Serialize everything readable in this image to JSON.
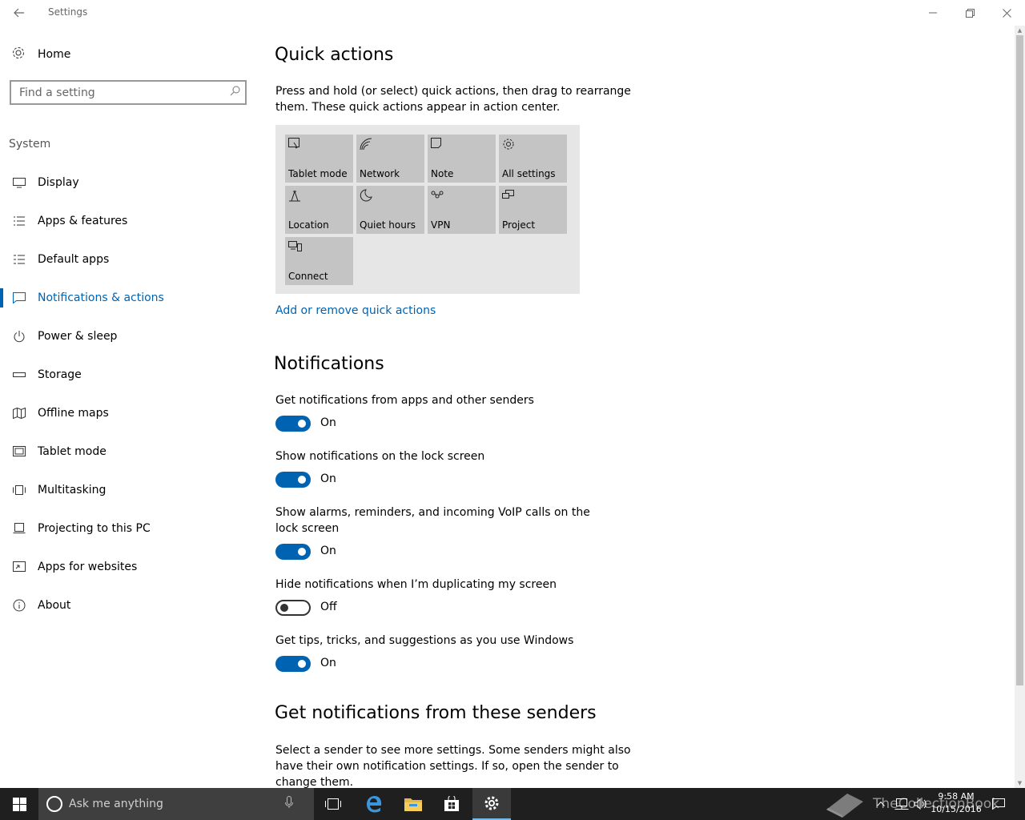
{
  "window": {
    "title": "Settings"
  },
  "sidebar": {
    "home_label": "Home",
    "search_placeholder": "Find a setting",
    "section_label": "System",
    "items": [
      {
        "label": "Display",
        "icon": "monitor-icon"
      },
      {
        "label": "Apps & features",
        "icon": "list-icon"
      },
      {
        "label": "Default apps",
        "icon": "default-apps-icon"
      },
      {
        "label": "Notifications & actions",
        "icon": "notification-icon",
        "active": true
      },
      {
        "label": "Power & sleep",
        "icon": "power-icon"
      },
      {
        "label": "Storage",
        "icon": "storage-icon"
      },
      {
        "label": "Offline maps",
        "icon": "map-icon"
      },
      {
        "label": "Tablet mode",
        "icon": "tablet-icon"
      },
      {
        "label": "Multitasking",
        "icon": "multitasking-icon"
      },
      {
        "label": "Projecting to this PC",
        "icon": "projecting-icon"
      },
      {
        "label": "Apps for websites",
        "icon": "apps-websites-icon"
      },
      {
        "label": "About",
        "icon": "info-icon"
      }
    ]
  },
  "quick_actions": {
    "heading": "Quick actions",
    "description": "Press and hold (or select) quick actions, then drag to rearrange them. These quick actions appear in action center.",
    "tiles": [
      {
        "label": "Tablet mode",
        "icon": "tablet-mode-icon"
      },
      {
        "label": "Network",
        "icon": "network-icon"
      },
      {
        "label": "Note",
        "icon": "note-icon"
      },
      {
        "label": "All settings",
        "icon": "gear-icon"
      },
      {
        "label": "Location",
        "icon": "location-icon"
      },
      {
        "label": "Quiet hours",
        "icon": "moon-icon"
      },
      {
        "label": "VPN",
        "icon": "vpn-icon"
      },
      {
        "label": "Project",
        "icon": "project-icon"
      },
      {
        "label": "Connect",
        "icon": "connect-icon"
      }
    ],
    "link": "Add or remove quick actions"
  },
  "notifications": {
    "heading": "Notifications",
    "settings": [
      {
        "label": "Get notifications from apps and other senders",
        "state": "On",
        "on": true
      },
      {
        "label": "Show notifications on the lock screen",
        "state": "On",
        "on": true
      },
      {
        "label": "Show alarms, reminders, and incoming VoIP calls on the lock screen",
        "state": "On",
        "on": true
      },
      {
        "label": "Hide notifications when I’m duplicating my screen",
        "state": "Off",
        "on": false
      },
      {
        "label": "Get tips, tricks, and suggestions as you use Windows",
        "state": "On",
        "on": true
      }
    ]
  },
  "senders": {
    "heading": "Get notifications from these senders",
    "description": "Select a sender to see more settings. Some senders might also have their own notification settings. If so, open the sender to change them."
  },
  "taskbar": {
    "search_placeholder": "Ask me anything",
    "time": "9:58 AM",
    "date": "10/15/2016",
    "watermark": "TheCollectionBook"
  },
  "colors": {
    "accent": "#0063b1",
    "tile": "#c4c4c4",
    "panel": "#e6e6e6",
    "taskbar": "#1f1f1f"
  }
}
